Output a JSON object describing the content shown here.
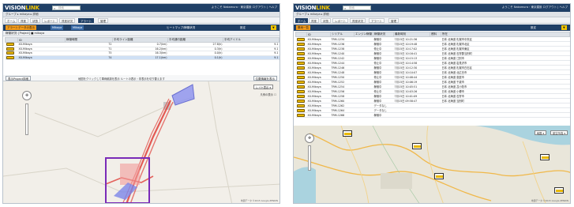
{
  "brand": {
    "name_part1": "VISION",
    "name_part2": "LINK"
  },
  "search_placeholder": "検索",
  "panels": [
    {
      "user_info": "ようこそ Nakamura・東京建設 ログアウト | ヘルプ",
      "breadcrumb": "グループ ▸ mikaya ▸ 詳細",
      "tabs": [
        "ホーム",
        "資産",
        "状態",
        "レポート",
        "資産状況",
        "アラート",
        "管理"
      ],
      "active_tab": 5,
      "toolbar": {
        "btn1": "アラートデータの表示",
        "btn2": "Mikaya",
        "btn3": "Mikaya",
        "btn4": "ヒートマップ/稼働状況",
        "btn5": "設定"
      },
      "subbar": "稼働状況: [Project] ■ mikaya",
      "table": {
        "headers": [
          "",
          "ID",
          "稼働時間",
          "平均ライン距離",
          "平均通行距離",
          "平均アイドル"
        ],
        "rows": [
          {
            "id": "XX-Mikaya",
            "v1": "72",
            "v2": "0.7(km)",
            "v3": "27.8(h)",
            "v4": "9.1"
          },
          {
            "id": "XX-Mikaya",
            "v1": "71",
            "v2": "16.2(km)",
            "v3": "0.3(h)",
            "v4": "9.1"
          },
          {
            "id": "XX-Mikaya",
            "v1": "75",
            "v2": "16.3(km)",
            "v3": "0.0(h)",
            "v4": "9.1"
          },
          {
            "id": "XX-Mikaya",
            "v1": "74",
            "v2": "17.1(km)",
            "v3": "0.1(h)",
            "v4": "9.1"
          }
        ],
        "selected_row": 3
      },
      "mapbar": {
        "left_btn": "表示Project詳細",
        "note": "地図をクリックして車両軌跡を表示 ルートの表示・非表示を切り替えます",
        "right_btn": "位置情報を表示"
      },
      "layer_button": "レイヤ表示 ▾",
      "layer_note": "凡例の表示 ☐",
      "copyright": "地図データ ©2015 Google ZENRIN"
    },
    {
      "user_info": "ようこそ Nakamura・東京建設 ログアウト | ヘルプ",
      "breadcrumb": "グループ ▸ mikaya ▸ 詳細",
      "tabs": [
        "ホーム",
        "資産",
        "状態",
        "レポート",
        "資産状況",
        "アラート",
        "管理"
      ],
      "active_tab": 0,
      "toolbar": {
        "btn1": "車両一覧",
        "btn5": "設定"
      },
      "table": {
        "headers": [
          "",
          "ID",
          "シリアル",
          "エンジン稼働",
          "稼働状況",
          "最新時刻",
          "燃料",
          "所在"
        ],
        "rows": [
          {
            "id": "XX-Mikaya",
            "serial": "TRM-1234",
            "state": "稼働中",
            "time": "7月15日 10:21:36",
            "loc": "日本 北海道 札幌市中央区"
          },
          {
            "id": "XX-Mikaya",
            "serial": "TRM-1236",
            "state": "稼働中",
            "time": "7月15日 10:19:48",
            "loc": "日本 北海道 札幌市北区"
          },
          {
            "id": "XX-Mikaya",
            "serial": "TRM-1238",
            "state": "停止中",
            "time": "7月15日 10:17:02",
            "loc": "日本 北海道 札幌市東区"
          },
          {
            "id": "XX-Mikaya",
            "serial": "TRM-1240",
            "state": "稼働中",
            "time": "7月15日 10:16:41",
            "loc": "日本 北海道 石狩郡当別町"
          },
          {
            "id": "XX-Mikaya",
            "serial": "TRM-1242",
            "state": "稼働中",
            "time": "7月15日 10:15:13",
            "loc": "日本 北海道 江別市"
          },
          {
            "id": "XX-Mikaya",
            "serial": "TRM-1244",
            "state": "停止中",
            "time": "7月15日 10:14:58",
            "loc": "日本 北海道 岩見沢市"
          },
          {
            "id": "XX-Mikaya",
            "serial": "TRM-1246",
            "state": "稼働中",
            "time": "7月15日 10:12:30",
            "loc": "日本 北海道 札幌市白石区"
          },
          {
            "id": "XX-Mikaya",
            "serial": "TRM-1248",
            "state": "稼働中",
            "time": "7月15日 10:10:07",
            "loc": "日本 北海道 北広島市"
          },
          {
            "id": "XX-Mikaya",
            "serial": "TRM-1250",
            "state": "停止中",
            "time": "7月15日 10:08:44",
            "loc": "日本 北海道 恵庭市"
          },
          {
            "id": "XX-Mikaya",
            "serial": "TRM-1252",
            "state": "稼働中",
            "time": "7月15日 10:06:19",
            "loc": "日本 北海道 千歳市"
          },
          {
            "id": "XX-Mikaya",
            "serial": "TRM-1254",
            "state": "稼働中",
            "time": "7月15日 10:05:51",
            "loc": "日本 北海道 苫小牧市"
          },
          {
            "id": "XX-Mikaya",
            "serial": "TRM-1256",
            "state": "停止中",
            "time": "7月15日 10:03:26",
            "loc": "日本 北海道 小樽市"
          },
          {
            "id": "XX-Mikaya",
            "serial": "TRM-1258",
            "state": "稼働中",
            "time": "7月15日 10:01:09",
            "loc": "日本 北海道 石狩市"
          },
          {
            "id": "XX-Mikaya",
            "serial": "TRM-1260",
            "state": "稼働中",
            "time": "7月15日 09:58:47",
            "loc": "日本 北海道 当別町"
          },
          {
            "id": "XX-Mikaya",
            "serial": "TRM-1262",
            "state": "データなし",
            "time": "",
            "loc": ""
          },
          {
            "id": "XX-Mikaya",
            "serial": "TRM-1264",
            "state": "データなし",
            "time": "",
            "loc": ""
          },
          {
            "id": "XX-Mikaya",
            "serial": "TRM-1266",
            "state": "稼働中",
            "time": "",
            "loc": ""
          }
        ]
      },
      "map_buttons": [
        "地図 ▾",
        "航空写真 ▾"
      ],
      "copyright": "地図データ ©2015 Google ZENRIN"
    }
  ],
  "colors": {
    "header": "#1f3f66",
    "accent_orange": "#f29a1a",
    "accent_yellow": "#f2c500",
    "route_red": "#e0403a",
    "zone_purple": "#7a2bb8",
    "zone_blue": "#7c86e8"
  }
}
